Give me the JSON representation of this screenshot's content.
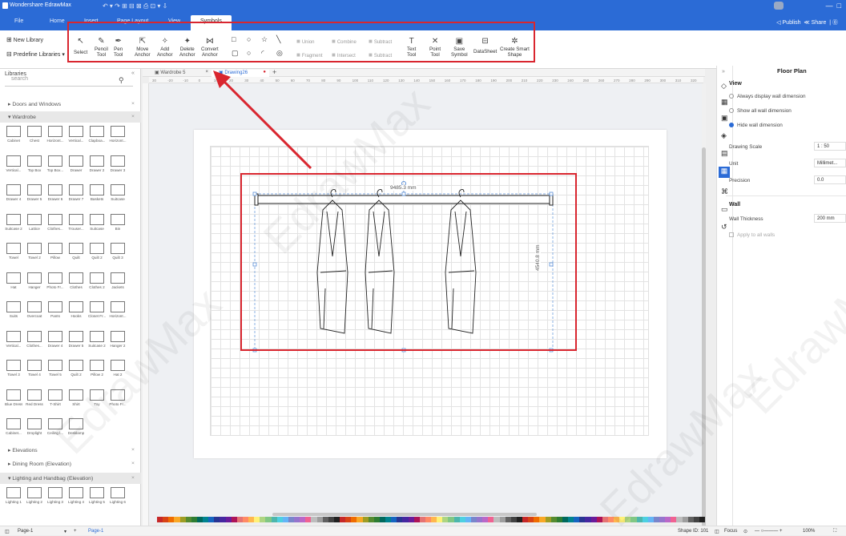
{
  "app": {
    "title": "Wondershare EdrawMax"
  },
  "menu": {
    "tabs": [
      "File",
      "Home",
      "Insert",
      "Page Layout",
      "View",
      "Symbols"
    ],
    "active": "Symbols",
    "publish": "Publish",
    "share": "Share"
  },
  "ribbon": {
    "new_library": "New Library",
    "predefine": "Predefine Libraries",
    "tools": [
      {
        "label": "Select",
        "icon": "pointer-icon"
      },
      {
        "label": "Pencil\nTool",
        "icon": "pencil-icon"
      },
      {
        "label": "Pen\nTool",
        "icon": "pen-icon"
      },
      {
        "label": "Move\nAnchor",
        "icon": "move-anchor-icon"
      },
      {
        "label": "Add\nAnchor",
        "icon": "add-anchor-icon"
      },
      {
        "label": "Delete\nAnchor",
        "icon": "delete-anchor-icon"
      },
      {
        "label": "Convert\nAnchor",
        "icon": "convert-anchor-icon"
      }
    ],
    "boolean_ops": [
      "Union",
      "Combine",
      "Subtract",
      "Fragment",
      "Intersect",
      "Subtract"
    ],
    "tools2": [
      {
        "label": "Text\nTool",
        "icon": "text-tool-icon"
      },
      {
        "label": "Point\nTool",
        "icon": "point-tool-icon"
      },
      {
        "label": "Save\nSymbol",
        "icon": "save-symbol-icon"
      },
      {
        "label": "DataSheet",
        "icon": "datasheet-icon"
      },
      {
        "label": "Create Smart\nShape",
        "icon": "smart-shape-icon"
      }
    ]
  },
  "libraries": {
    "title": "Libraries",
    "search_placeholder": "search",
    "categories_top": [
      "Doors and Windows",
      "Wardrobe"
    ],
    "wardrobe_rows": [
      [
        "Cabinet",
        "Chest",
        "Horizont...",
        "Vertical...",
        "Clapboa...",
        "Horizont..."
      ],
      [
        "Vertical...",
        "Top Box",
        "Top Box...",
        "Drawer",
        "Drawer 2",
        "Drawer 3"
      ],
      [
        "Drawer 4",
        "Drawer 5",
        "Drawer 6",
        "Drawer 7",
        "Baskets",
        "Suitcase"
      ],
      [
        "Suitcase 2",
        "Lattice",
        "Clothes...",
        "Trouser...",
        "Suitcase",
        "Bin"
      ],
      [
        "Towel",
        "Towel 2",
        "Pillow",
        "Quilt",
        "Quilt 2",
        "Quilt 3"
      ],
      [
        "Hat",
        "Hanger",
        "Photo Fr...",
        "Clothes",
        "Clothes 2",
        "Jackets"
      ],
      [
        "Suits",
        "Overcoat",
        "Pants",
        "Hooks",
        "Closet Fr...",
        "Horizont..."
      ],
      [
        "Vertical...",
        "Clothes...",
        "Drawer 4",
        "Drawer 5",
        "Suitcase 2",
        "Hanger 2"
      ],
      [
        "Towel 3",
        "Towel 4",
        "Towel 5",
        "Quilt 2",
        "Pillow 2",
        "Hat 2"
      ],
      [
        "Blue Dress",
        "Red Dress",
        "T-Shirt",
        "Shirt",
        "Toy",
        "Photo Fr..."
      ],
      [
        "Cabinet...",
        "Droplight",
        "Ceiling l...",
        "Desklamp"
      ]
    ],
    "categories_bottom": [
      "Elevations",
      "Dining Room (Elevation)",
      "Lighting and Handbag (Elevation)"
    ],
    "lighting_row": [
      "Lighting 1",
      "Lighting 2",
      "Lighting 3",
      "Lighting 4",
      "Lighting 5",
      "Lighting 6"
    ]
  },
  "doc_tabs": [
    {
      "label": "Wardrobe 5"
    },
    {
      "label": "Drawing26"
    }
  ],
  "ruler_labels": [
    "30",
    "-20",
    "-10",
    "0",
    "10",
    "20",
    "30",
    "40",
    "50",
    "60",
    "70",
    "80",
    "90",
    "100",
    "110",
    "120",
    "130",
    "140",
    "150",
    "160",
    "170",
    "180",
    "190",
    "200",
    "210",
    "220",
    "230",
    "240",
    "250",
    "260",
    "270",
    "280",
    "290",
    "300",
    "310",
    "320"
  ],
  "drawing": {
    "width_label": "9485.3 mm",
    "height_label": "4540.8 mm"
  },
  "right_panel": {
    "title": "Floor Plan",
    "view": "View",
    "options": [
      {
        "label": "Always display wall dimension",
        "on": false
      },
      {
        "label": "Show all wall dimension",
        "on": false
      },
      {
        "label": "Hide wall dimension",
        "on": true
      }
    ],
    "drawing_scale": "Drawing Scale",
    "drawing_scale_value": "1 : 50",
    "unit": "Unit",
    "unit_value": "Millimet...",
    "precision": "Precision",
    "precision_value": "0.0",
    "wall": "Wall",
    "wall_thickness": "Wall Thickness",
    "wall_thickness_value": "200 mm",
    "apply_all": "Apply to all walls"
  },
  "status": {
    "page_name": "Page-1",
    "page_tab": "Page-1",
    "shape_id": "Shape ID: 101",
    "focus": "Focus",
    "zoom": "100%"
  },
  "watermark": "EdrawMax",
  "colors": {
    "titlebar": "#2b6bd6",
    "highlight": "#d9262f",
    "accent": "#2b6bd6"
  }
}
